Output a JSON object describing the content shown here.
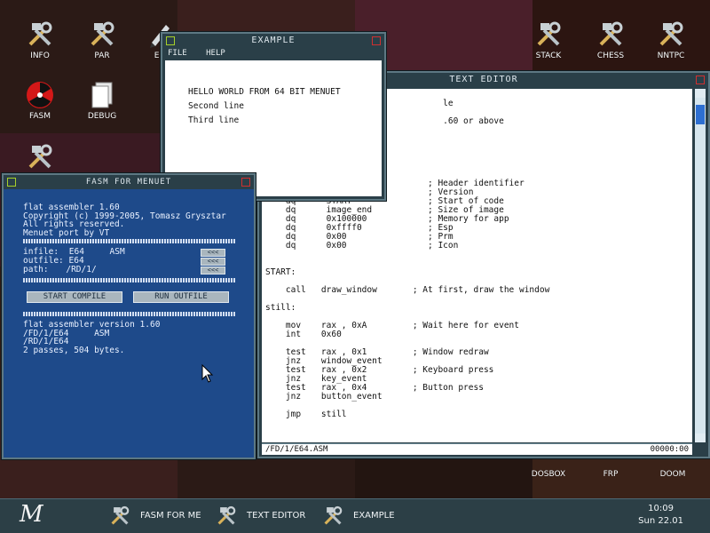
{
  "desktop": {
    "icons": [
      {
        "label": "INFO",
        "icon": "tools-icon"
      },
      {
        "label": "PAR",
        "icon": "tools-icon"
      },
      {
        "label": "ED",
        "icon": "pen-icon"
      },
      {
        "label": "FASM",
        "icon": "radiation-icon"
      },
      {
        "label": "DEBUG",
        "icon": "documents-icon"
      },
      {
        "label": "",
        "icon": "tools-icon"
      },
      {
        "label": "STACK",
        "icon": "tools-icon"
      },
      {
        "label": "CHESS",
        "icon": "tools-icon"
      },
      {
        "label": "NNTPC",
        "icon": "tools-icon"
      },
      {
        "label": "DOSBOX",
        "icon": "tools-icon"
      },
      {
        "label": "FRP",
        "icon": "tools-icon"
      },
      {
        "label": "DOOM",
        "icon": "tools-icon"
      }
    ],
    "tile_colors": [
      "#2b1a16",
      "#3a1f1d",
      "#2c1511",
      "#4a1f2a",
      "#3a2218",
      "#2b1713",
      "#3a1a22",
      "#2f1a15",
      "#201512",
      "#2f1b14",
      "#251510",
      "#2a1814"
    ]
  },
  "example_window": {
    "title": "EXAMPLE",
    "menu": [
      "FILE",
      "HELP"
    ],
    "lines": [
      "HELLO WORLD FROM 64 BIT MENUET",
      "Second line",
      "Third line"
    ]
  },
  "text_editor": {
    "title": "TEXT EDITOR",
    "code_lines": [
      "                                   le",
      "",
      "                                   .60 or above",
      "",
      "",
      "",
      "",
      "",
      "",
      "    db      MENUET64            ; Header identifier",
      "    dq      0x01                ; Version",
      "    dq      START               ; Start of code",
      "    dq      image_end           ; Size of image",
      "    dq      0x100000            ; Memory for app",
      "    dq      0xffff0             ; Esp",
      "    dq      0x00                ; Prm",
      "    dq      0x00                ; Icon",
      "",
      "",
      "START:",
      "",
      "    call   draw_window       ; At first, draw the window",
      "",
      "still:",
      "",
      "    mov    rax , 0xA         ; Wait here for event",
      "    int    0x60",
      "",
      "    test   rax , 0x1         ; Window redraw",
      "    jnz    window_event",
      "    test   rax , 0x2         ; Keyboard press",
      "    jnz    key_event",
      "    test   rax , 0x4         ; Button press",
      "    jnz    button_event",
      "",
      "    jmp    still"
    ],
    "status_path": "/FD/1/E64.ASM",
    "status_pos": "00000:00"
  },
  "fasm_window": {
    "title": "FASM FOR MENUET",
    "header_lines": [
      "flat assembler 1.60",
      "Copyright (c) 1999-2005, Tomasz Grysztar",
      "All rights reserved.",
      "Menuet port by VT"
    ],
    "infile_label": "infile:",
    "infile_value": "E64     ASM",
    "outfile_label": "outfile:",
    "outfile_value": "E64",
    "path_label": "path:",
    "path_value": "/RD/1/",
    "mini_button": "<<<",
    "start_compile": "START COMPILE",
    "run_outfile": "RUN OUTFILE",
    "result_lines": [
      "flat assembler  version 1.60",
      "/FD/1/E64     ASM",
      "/RD/1/E64",
      "2 passes, 504 bytes."
    ]
  },
  "taskbar": {
    "logo": "M",
    "tasks": [
      "FASM FOR ME",
      "TEXT EDITOR",
      "EXAMPLE"
    ],
    "time": "10:09",
    "date": "Sun 22.01"
  }
}
